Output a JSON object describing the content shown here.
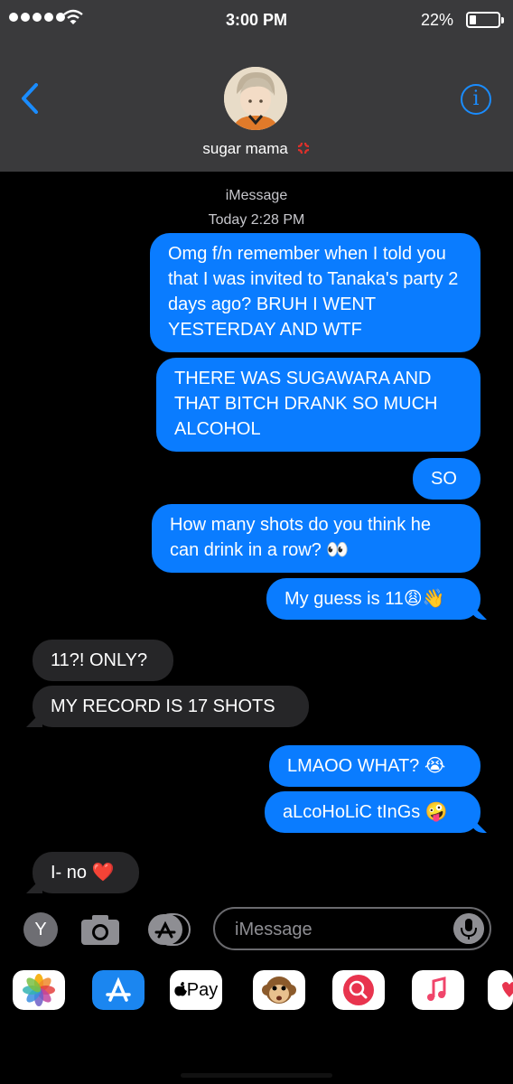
{
  "status_bar": {
    "time": "3:00 PM",
    "battery_percent": "22%",
    "battery_level": 0.22,
    "signal_bars": 5,
    "icons": [
      "signal-dots-icon",
      "wifi-icon",
      "battery-icon"
    ]
  },
  "header": {
    "contact_name": "sugar mama",
    "back_icon": "chevron-left-icon",
    "info_icon": "info-icon",
    "accent_color": "#1a8cff"
  },
  "thread": {
    "service": "iMessage",
    "timestamp": "Today 2:28 PM",
    "messages": [
      {
        "dir": "out",
        "text": "Omg f/n remember when I told you that I was invited to Tanaka's party 2 days ago? BRUH I WENT YESTERDAY AND WTF"
      },
      {
        "dir": "out",
        "text": "THERE WAS SUGAWARA AND THAT BITCH DRANK SO MUCH ALCOHOL"
      },
      {
        "dir": "out",
        "text": "SO"
      },
      {
        "dir": "out",
        "text": "How many shots do you think he can drink in a row? 👀"
      },
      {
        "dir": "out",
        "text": "My guess is 11😩👋"
      },
      {
        "dir": "in",
        "text": "11?! ONLY?"
      },
      {
        "dir": "in",
        "text": "MY RECORD IS 17 SHOTS"
      },
      {
        "dir": "out",
        "text": "LMAOO WHAT? 😭"
      },
      {
        "dir": "out",
        "text": "aLcoHoLiC tInGs 🤪"
      },
      {
        "dir": "in",
        "text": "I- no ❤️"
      }
    ]
  },
  "composer": {
    "placeholder": "iMessage",
    "icons": [
      "keyboard-y-icon",
      "camera-icon",
      "app-store-icon",
      "mic-icon"
    ]
  },
  "app_drawer": {
    "apple_pay_label": "Pay",
    "apps": [
      "photos-icon",
      "app-store-icon",
      "apple-pay-icon",
      "animoji-monkey-icon",
      "web-search-icon",
      "music-icon",
      "digital-touch-icon"
    ]
  },
  "colors": {
    "outgoing_bubble": "#0a7cff",
    "incoming_bubble": "#262628",
    "header_bg": "#3a3a3c"
  }
}
